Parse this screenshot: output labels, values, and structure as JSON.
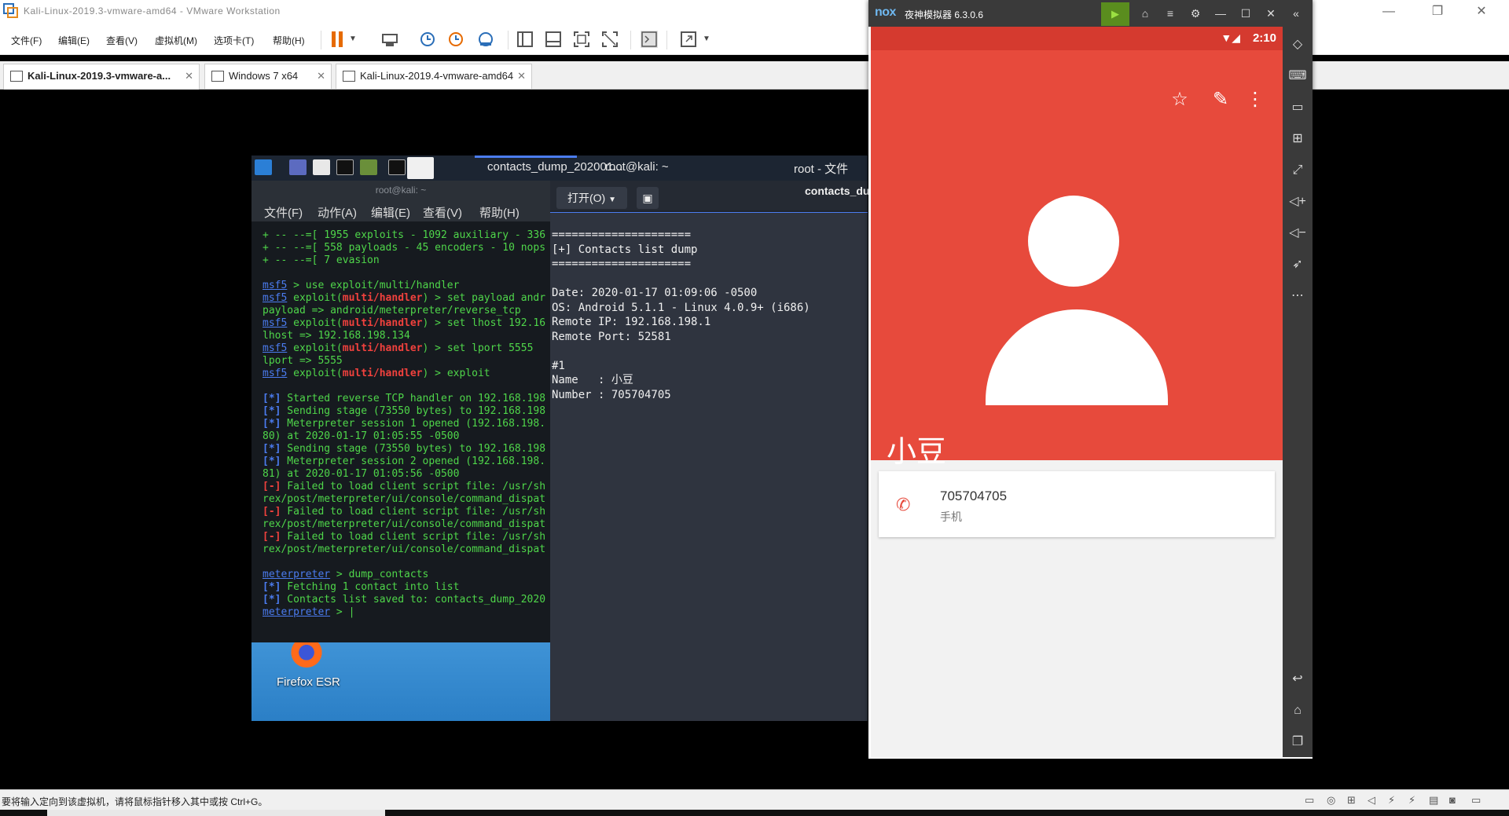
{
  "vmware": {
    "window_title": "Kali-Linux-2019.3-vmware-amd64 - VMware Workstation",
    "menu": [
      "文件(F)",
      "编辑(E)",
      "查看(V)",
      "虚拟机(M)",
      "选项卡(T)",
      "帮助(H)"
    ],
    "tabs": [
      {
        "label": "Kali-Linux-2019.3-vmware-a...",
        "active": true
      },
      {
        "label": "Windows 7 x64",
        "active": false
      },
      {
        "label": "Kali-Linux-2019.4-vmware-amd64",
        "active": false
      }
    ],
    "status_text": "要将输入定向到该虚拟机，请将鼠标指针移入其中或按 Ctrl+G。"
  },
  "kali_panel": {
    "tasks": [
      "contacts_dump_202001...",
      "root@kali: ~",
      "root - 文件"
    ]
  },
  "terminal": {
    "title": "root@kali: ~",
    "menu": [
      "文件(F)",
      "动作(A)",
      "编辑(E)",
      "查看(V)",
      "帮助(H)"
    ]
  },
  "desktop": {
    "firefox_label": "Firefox ESR"
  },
  "viewer": {
    "open_button": "打开(O)",
    "title": "contacts_du",
    "body": "=====================\n[+] Contacts list dump\n=====================\n\nDate: 2020-01-17 01:09:06 -0500\nOS: Android 5.1.1 - Linux 4.0.9+ (i686)\nRemote IP: 192.168.198.1\nRemote Port: 52581\n\n#1\nName   : 小豆\nNumber : 705704705"
  },
  "nox": {
    "logo": "nox",
    "title": "夜神模拟器 6.3.0.6",
    "status_time": "2:10",
    "contact_name": "小豆",
    "phone_number": "705704705",
    "phone_type": "手机"
  },
  "colors": {
    "contact_header": "#e74a3c",
    "status_bar": "#d53a2f",
    "terminal_green": "#4fd64a",
    "terminal_red": "#f0413d",
    "terminal_blue": "#4b7cf0"
  }
}
